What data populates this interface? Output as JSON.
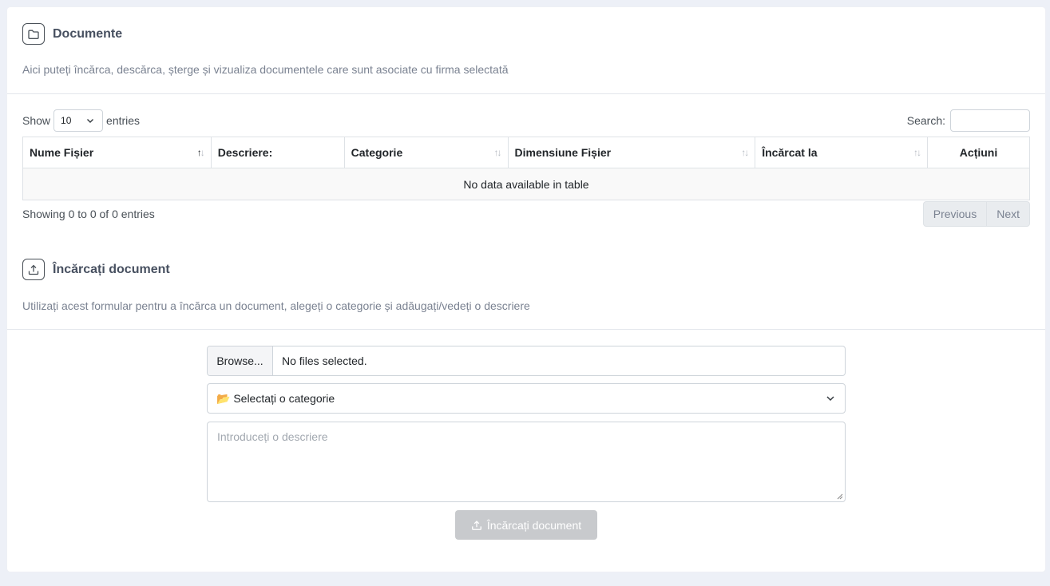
{
  "documents": {
    "title": "Documente",
    "description": "Aici puteți încărca, descărca, șterge și vizualiza documentele care sunt asociate cu firma selectată",
    "icon": "folder-icon"
  },
  "table": {
    "show_label": "Show",
    "entries_label": "entries",
    "page_length": "10",
    "search_label": "Search:",
    "search_value": "",
    "columns": [
      {
        "label": "Nume Fișier",
        "sortable": true,
        "active": true
      },
      {
        "label": "Descriere:",
        "sortable": false
      },
      {
        "label": "Categorie",
        "sortable": true
      },
      {
        "label": "Dimensiune Fișier",
        "sortable": true
      },
      {
        "label": "Încărcat la",
        "sortable": true
      },
      {
        "label": "Acțiuni",
        "sortable": false
      }
    ],
    "empty_message": "No data available in table",
    "info": "Showing 0 to 0 of 0 entries",
    "prev_label": "Previous",
    "next_label": "Next"
  },
  "upload": {
    "title": "Încărcați document",
    "description": "Utilizați acest formular pentru a încărca un document, alegeți o categorie și adăugați/vedeți o descriere",
    "icon": "upload-icon",
    "browse_label": "Browse...",
    "file_status": "No files selected.",
    "category_placeholder": "📂 Selectați o categorie",
    "description_placeholder": "Introduceți o descriere",
    "submit_label": "Încărcați document"
  },
  "colors": {
    "page_bg": "#edf0f7",
    "card_bg": "#ffffff",
    "disabled_button": "#c8cacd",
    "muted_text": "#7a8291"
  }
}
